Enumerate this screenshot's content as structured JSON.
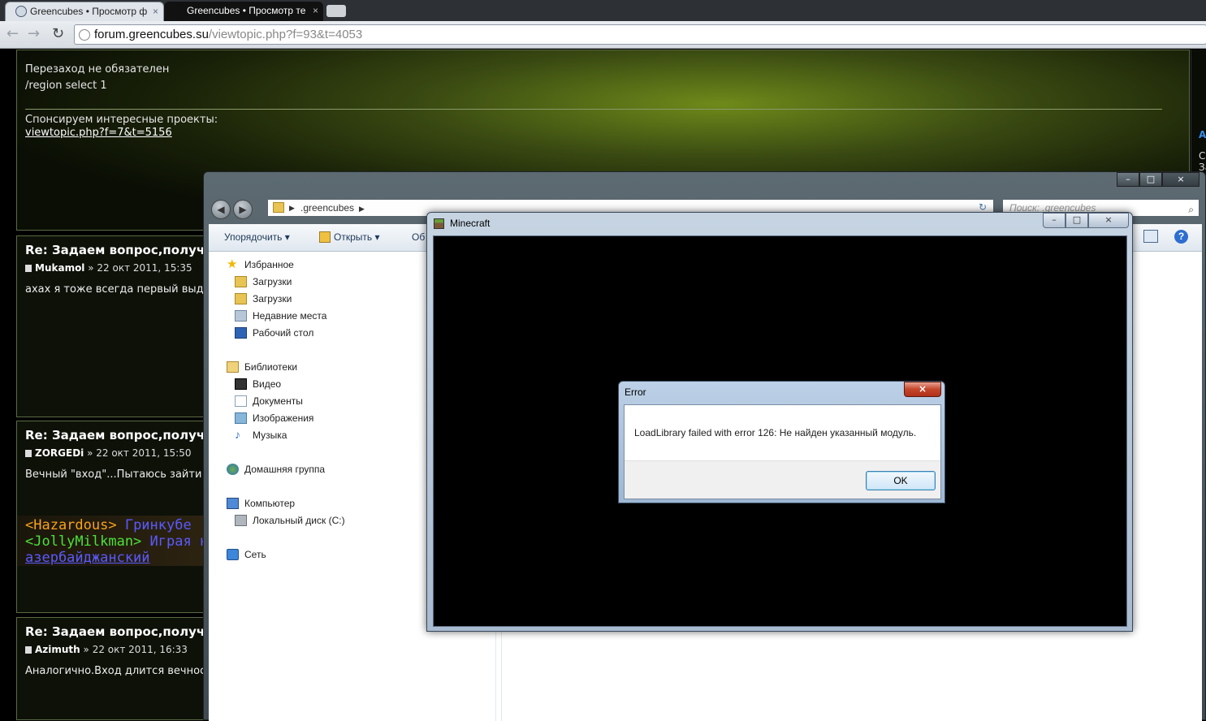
{
  "browser": {
    "tabs": [
      {
        "label": "Greencubes • Просмотр ф",
        "active": true
      },
      {
        "label": "Greencubes • Просмотр те",
        "active": false
      }
    ],
    "close_glyph": "×",
    "url_host": "forum.greencubes.su",
    "url_path": "/viewtopic.php?f=93&t=4053"
  },
  "forum": {
    "top_post": {
      "line1": "Перезаход не обязателен",
      "line2": "/region select 1",
      "sponsor": "Спонсируем интересные проекты:",
      "link": "viewtopic.php?f=7&t=5156"
    },
    "side": {
      "a": "A",
      "c1": "С",
      "c2": "За"
    },
    "posts": [
      {
        "title": "Re: Задаем вопрос,получа",
        "author": "Mukamol",
        "date": " » 22 окт 2011, 15:35",
        "body": "ахах я тоже всегда первый выдел"
      },
      {
        "title": "Re: Задаем вопрос,получа",
        "author": "ZORGEDi",
        "date": " » 22 окт 2011, 15:50",
        "body": "Вечный \"вход\"...Пытаюсь зайти на"
      },
      {
        "title": "Re: Задаем вопрос,получа",
        "author": "Azimuth",
        "date": " » 22 окт 2011, 16:33",
        "body": "Аналогично.Вход длится вечность"
      }
    ],
    "chat": {
      "l1_name": "<Hazardous>",
      "l1_text": " Гринкубе",
      "l2_name": "<JollyMilkman>",
      "l2_text": " Играя н",
      "l3_text": "азербайджанский"
    }
  },
  "explorer": {
    "controls": {
      "min": "–",
      "max": "□",
      "close": "×"
    },
    "address": ".greencubes",
    "search_placeholder": "Поиск: .greencubes",
    "commands": {
      "organize": "Упорядочить ▾",
      "open": "Открыть ▾",
      "share": "Об"
    },
    "nav": {
      "favorites": "Избранное",
      "downloads1": "Загрузки",
      "downloads2": "Загрузки",
      "recent": "Недавние места",
      "desktop": "Рабочий стол",
      "libraries": "Библиотеки",
      "video": "Видео",
      "documents": "Документы",
      "images": "Изображения",
      "music": "Музыка",
      "homegroup": "Домашняя группа",
      "computer": "Компьютер",
      "local_disk": "Локальный диск (C:)",
      "network": "Сеть"
    }
  },
  "minecraft": {
    "title": "Minecraft",
    "controls": {
      "min": "–",
      "max": "□",
      "close": "×"
    }
  },
  "error": {
    "title": "Error",
    "close": "×",
    "message": "LoadLibrary failed with error 126: Не найден указанный модуль.",
    "ok": "OK"
  }
}
